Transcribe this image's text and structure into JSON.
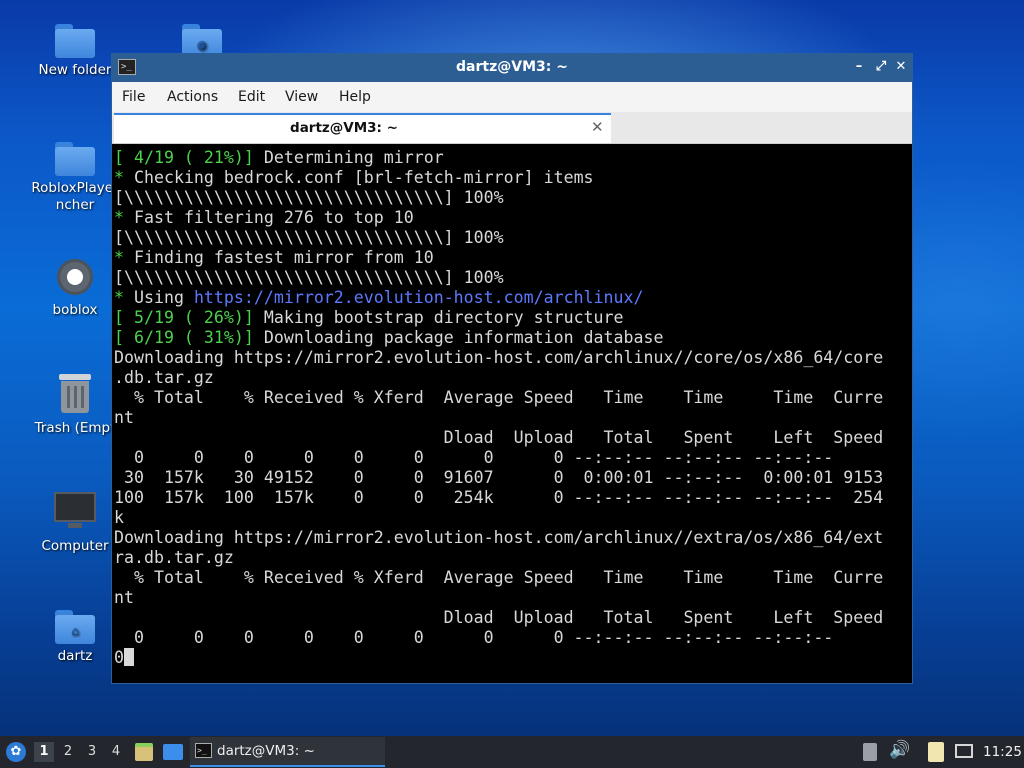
{
  "desktop": {
    "icons": [
      {
        "label": "New folder",
        "icon": "folder-icon"
      },
      {
        "label": "",
        "icon": "web-folder-icon"
      },
      {
        "label": "RobloxPlayer",
        "label2": "ncher",
        "icon": "folder-icon"
      },
      {
        "label": "boblox",
        "icon": "gear-icon"
      },
      {
        "label": "Trash (Empt",
        "icon": "trash-icon"
      },
      {
        "label": "Computer",
        "icon": "computer-icon"
      },
      {
        "label": "dartz",
        "icon": "home-folder-icon"
      }
    ]
  },
  "window": {
    "title": "dartz@VM3: ~",
    "menu": [
      "File",
      "Actions",
      "Edit",
      "View",
      "Help"
    ],
    "tab_label": "dartz@VM3: ~",
    "terminal_lines": [
      {
        "text": "[ 4/19 ( 21%)] Determining mirror",
        "style": "g-prefix",
        "prefix": "[ 4/19 ( 21%)]",
        "rest": " Determining mirror"
      },
      {
        "prefix": "*",
        "rest": " Checking bedrock.conf [brl-fetch-mirror] items"
      },
      {
        "prefix": "",
        "rest": "[\\\\\\\\\\\\\\\\\\\\\\\\\\\\\\\\\\\\\\\\\\\\\\\\\\\\\\\\\\\\\\\\] 100%"
      },
      {
        "prefix": "*",
        "rest": " Fast filtering 276 to top 10"
      },
      {
        "prefix": "",
        "rest": "[\\\\\\\\\\\\\\\\\\\\\\\\\\\\\\\\\\\\\\\\\\\\\\\\\\\\\\\\\\\\\\\\] 100%"
      },
      {
        "prefix": "*",
        "rest": " Finding fastest mirror from 10"
      },
      {
        "prefix": "",
        "rest": "[\\\\\\\\\\\\\\\\\\\\\\\\\\\\\\\\\\\\\\\\\\\\\\\\\\\\\\\\\\\\\\\\] 100%"
      },
      {
        "prefix": "*",
        "rest": " Using ",
        "url": "https://mirror2.evolution-host.com/archlinux/"
      },
      {
        "prefix": "[ 5/19 ( 26%)]",
        "rest": " Making bootstrap directory structure"
      },
      {
        "prefix": "[ 6/19 ( 31%)]",
        "rest": " Downloading package information database"
      },
      {
        "prefix": "",
        "rest": "Downloading https://mirror2.evolution-host.com/archlinux//core/os/x86_64/core"
      },
      {
        "prefix": "",
        "rest": ".db.tar.gz"
      },
      {
        "prefix": "",
        "rest": "  % Total    % Received % Xferd  Average Speed   Time    Time     Time  Curre"
      },
      {
        "prefix": "",
        "rest": "nt"
      },
      {
        "prefix": "",
        "rest": "                                 Dload  Upload   Total   Spent    Left  Speed"
      },
      {
        "prefix": "",
        "rest": "  0     0    0     0    0     0      0      0 --:--:-- --:--:-- --:--:--"
      },
      {
        "prefix": "",
        "rest": " 30  157k   30 49152    0     0  91607      0  0:00:01 --:--:--  0:00:01 9153"
      },
      {
        "prefix": "",
        "rest": "100  157k  100  157k    0     0   254k      0 --:--:-- --:--:-- --:--:--  254"
      },
      {
        "prefix": "",
        "rest": "k"
      },
      {
        "prefix": "",
        "rest": "Downloading https://mirror2.evolution-host.com/archlinux//extra/os/x86_64/ext"
      },
      {
        "prefix": "",
        "rest": "ra.db.tar.gz"
      },
      {
        "prefix": "",
        "rest": "  % Total    % Received % Xferd  Average Speed   Time    Time     Time  Curre"
      },
      {
        "prefix": "",
        "rest": "nt"
      },
      {
        "prefix": "",
        "rest": "                                 Dload  Upload   Total   Spent    Left  Speed"
      },
      {
        "prefix": "",
        "rest": "  0     0    0     0    0     0      0      0 --:--:-- --:--:-- --:--:--"
      },
      {
        "prefix": "",
        "rest": "0",
        "cursor": true
      }
    ]
  },
  "taskbar": {
    "workspaces": [
      "1",
      "2",
      "3",
      "4"
    ],
    "active_workspace": "1",
    "task_label": "dartz@VM3: ~",
    "clock": "11:25"
  },
  "colors": {
    "titlebar": "#2c5e94",
    "terminal_green": "#4cd14c",
    "terminal_url": "#5c78ff",
    "taskbar": "#23272d"
  }
}
